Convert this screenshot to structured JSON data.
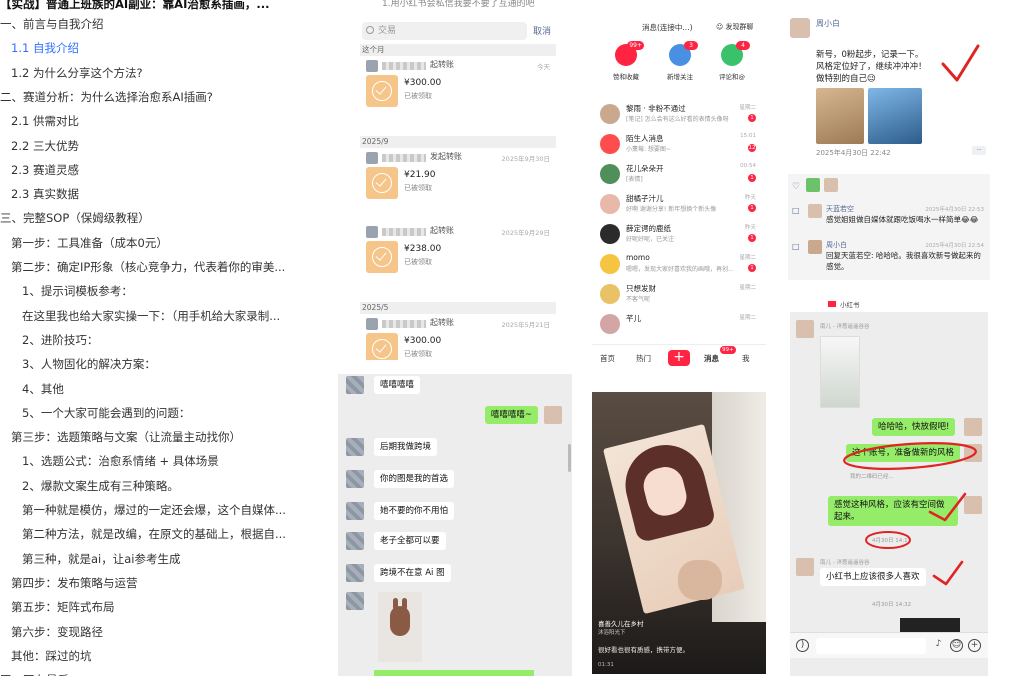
{
  "outline": {
    "title": "【实战】普通上班族的AI副业：靠AI治愈系插画，...",
    "items": [
      {
        "text": "一、前言与自我介绍",
        "level": 1,
        "active": false
      },
      {
        "text": "1.1 自我介绍",
        "level": 2,
        "active": true
      },
      {
        "text": "1.2 为什么分享这个方法?",
        "level": 2,
        "active": false
      },
      {
        "text": "二、赛道分析：为什么选择治愈系AI插画?",
        "level": 1,
        "active": false
      },
      {
        "text": "2.1 供需对比",
        "level": 2,
        "active": false
      },
      {
        "text": "2.2 三大优势",
        "level": 2,
        "active": false
      },
      {
        "text": "2.3 赛道灵感",
        "level": 2,
        "active": false
      },
      {
        "text": "2.3 真实数据",
        "level": 2,
        "active": false
      },
      {
        "text": "三、完整SOP（保姆级教程）",
        "level": 1,
        "active": false
      },
      {
        "text": "第一步：工具准备（成本0元）",
        "level": 2,
        "active": false
      },
      {
        "text": "第二步：确定IP形象（核心竞争力，代表着你的审美...",
        "level": 2,
        "active": false
      },
      {
        "text": "1、提示词模板参考：",
        "level": 3,
        "active": false
      },
      {
        "text": "在这里我也给大家实操一下：（用手机给大家录制...",
        "level": 3,
        "active": false
      },
      {
        "text": "2、进阶技巧：",
        "level": 3,
        "active": false
      },
      {
        "text": "3、人物固化的解决方案：",
        "level": 3,
        "active": false
      },
      {
        "text": "4、其他",
        "level": 3,
        "active": false
      },
      {
        "text": "5、一个大家可能会遇到的问题：",
        "level": 3,
        "active": false
      },
      {
        "text": "第三步：选题策略与文案（让流量主动找你）",
        "level": 2,
        "active": false
      },
      {
        "text": "1、选题公式：治愈系情绪 + 具体场景",
        "level": 3,
        "active": false
      },
      {
        "text": "2、爆款文案生成有三种策略。",
        "level": 3,
        "active": false
      },
      {
        "text": "第一种就是模仿，爆过的一定还会爆，这个自媒体...",
        "level": 3,
        "active": false
      },
      {
        "text": "第二种方法，就是改编，在原文的基础上，根据自...",
        "level": 3,
        "active": false
      },
      {
        "text": "第三种，就是ai，让ai参考生成",
        "level": 3,
        "active": false
      },
      {
        "text": "第四步：发布策略与运营",
        "level": 2,
        "active": false
      },
      {
        "text": "第五步：矩阵式布局",
        "level": 2,
        "active": false
      },
      {
        "text": "第六步：变现路径",
        "level": 2,
        "active": false
      },
      {
        "text": "其他：踩过的坑",
        "level": 2,
        "active": false
      },
      {
        "text": "四、写在最后",
        "level": 1,
        "active": false
      }
    ]
  },
  "transfers": {
    "top_caption": "1.用小红书会私信我要不要了互通的吧",
    "search_placeholder": "交易",
    "cancel_label": "取消",
    "sections": [
      {
        "label": "这个月",
        "records": [
          {
            "who": "起转账",
            "date": "今天",
            "amount": "¥300.00",
            "status": "已被领取"
          }
        ]
      },
      {
        "label": "2025/9",
        "records": [
          {
            "who": "发起转账",
            "date": "2025年9月30日",
            "amount": "¥21.90",
            "status": "已被领取"
          },
          {
            "who": "起转账",
            "date": "2025年9月29日",
            "amount": "¥238.00",
            "status": "已被领取"
          }
        ]
      },
      {
        "label": "2025/5",
        "records": [
          {
            "who": "起转账",
            "date": "2025年5月21日",
            "amount": "¥300.00",
            "status": "已被领取"
          }
        ]
      }
    ]
  },
  "messages": {
    "header": "消息(连接中...)",
    "group_label": "发现群聊",
    "quick": [
      {
        "label": "赞和收藏",
        "badge": "99+",
        "color": "#ff2442"
      },
      {
        "label": "新增关注",
        "badge": "3",
        "color": "#4a90e2"
      },
      {
        "label": "评论和@",
        "badge": "4",
        "color": "#39c16c"
      }
    ],
    "rows": [
      {
        "name": "黎雨 · 非粉不通过",
        "preview": "[笔记] 怎么会有这么好看的表情头像呀",
        "time": "星期二",
        "badge": "1",
        "color": "#c9a88e"
      },
      {
        "name": "陌生人消息",
        "preview": "小薰莓: 想要图~",
        "time": "15:01",
        "badge": "12",
        "color": "#ff4d4f"
      },
      {
        "name": "花儿朵朵开",
        "preview": "[表情]",
        "time": "00:54",
        "badge": "1",
        "color": "#4f8f5a"
      },
      {
        "name": "甜橘子汁儿",
        "preview": "好啊 谢谢分享! 新年想换个新头像",
        "time": "昨天",
        "badge": "1",
        "color": "#e8b9a8"
      },
      {
        "name": "薛定谔的鹿纸",
        "preview": "好呢好呢，已关注",
        "time": "昨天",
        "badge": "1",
        "color": "#2b2b2b"
      },
      {
        "name": "momo",
        "preview": "嗯嗯，发现大家好喜欢我的画哦，再创...",
        "time": "星期二",
        "badge": "1",
        "color": "#f5c542"
      },
      {
        "name": "只想发财",
        "preview": "不客气呢",
        "time": "星期二",
        "badge": "",
        "color": "#e9c268"
      },
      {
        "name": "芊儿",
        "preview": "",
        "time": "星期二",
        "badge": "",
        "color": "#d4a5a5"
      }
    ],
    "nav": {
      "home": "首页",
      "hot": "热门",
      "plus": "+",
      "msg": "消息",
      "msg_badge": "99+",
      "me": "我"
    }
  },
  "video": {
    "author": "喜善久儿在乡村",
    "subtitle": "沐浴阳光下",
    "desc": "很好看也很有质感，携带方便。",
    "time": "01:31"
  },
  "chat": {
    "messages": [
      {
        "dir": "in",
        "text": "嘻嘻嘻嘻"
      },
      {
        "dir": "out",
        "text": "嘻嘻嘻嘻~"
      },
      {
        "dir": "in",
        "text": "后期我做跨境"
      },
      {
        "dir": "in",
        "text": "你的图是我的首选"
      },
      {
        "dir": "in",
        "text": "她不要的你不用怕"
      },
      {
        "dir": "in",
        "text": "老子全都可以要"
      },
      {
        "dir": "in",
        "text": "跨境不在意 Ai 图"
      }
    ]
  },
  "post": {
    "user": "周小白",
    "lines": [
      "新号，0粉起步，记录一下。",
      "风格定位好了，继续冲冲冲！",
      "做特别的自己😉"
    ],
    "date": "2025年4月30日 22:42",
    "likers_label": "♡",
    "comments": [
      {
        "name": "天蓝若空",
        "date": "2025年4月30日 22:53",
        "text": "感觉姐姐做自媒体就跟吃饭喝水一样简单😂😂",
        "color": "#d9bfae"
      },
      {
        "name": "周小白",
        "date": "2025年4月30日 22:54",
        "text": "回复天蓝若空: 哈哈哈。我很喜欢新号做起来的感觉。",
        "color": "#c9a88e"
      }
    ]
  },
  "chat2": {
    "header": "小红书",
    "sender": "南儿 - 洋葱遥遥谷谷",
    "m1": "哈哈哈，快放假吧!",
    "m2": "这个账号，准备做新的风格",
    "m2_note": "我的二维码已经...",
    "m3": "感觉这种风格，应该有空间做起来。",
    "stamp1": "4月30日 14:11",
    "sender2": "南儿 - 洋葱遥遥谷谷",
    "m4": "小红书上应该很多人喜欢",
    "stamp2": "4月30日 14:32"
  }
}
